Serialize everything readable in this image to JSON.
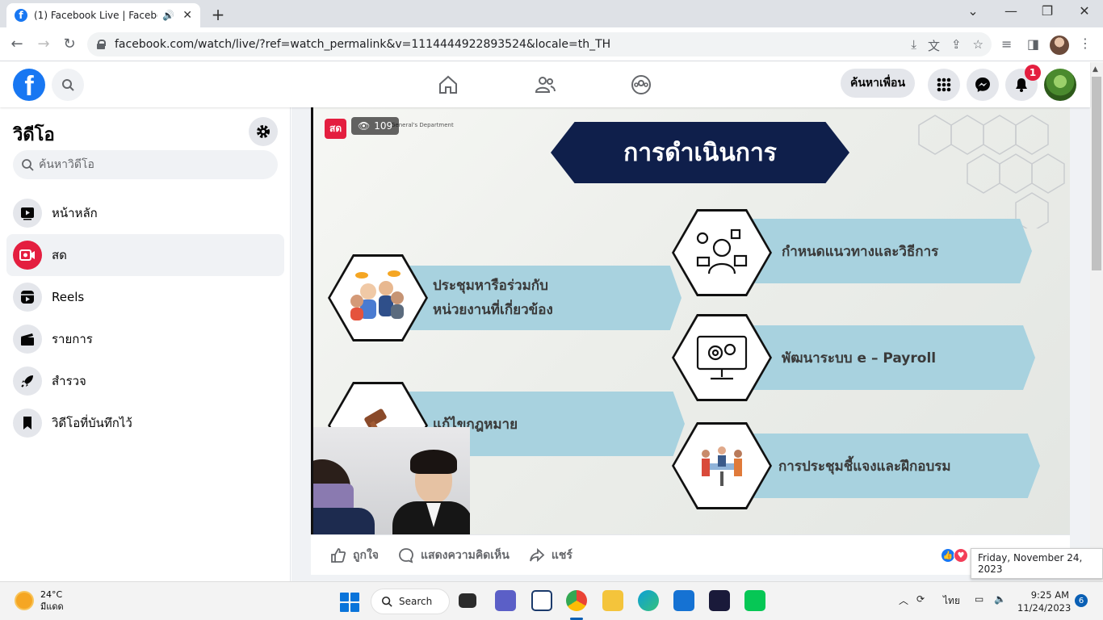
{
  "browser": {
    "tab_title": "(1) Facebook Live | Facebook",
    "url": "facebook.com/watch/live/?ref=watch_permalink&v=1114444922893524&locale=th_TH"
  },
  "header": {
    "find_friends": "ค้นหาเพื่อน",
    "notification_count": "1"
  },
  "sidebar": {
    "title": "วิดีโอ",
    "search_placeholder": "ค้นหาวิดีโอ",
    "items": [
      {
        "label": "หน้าหลัก",
        "icon": "video-play-icon"
      },
      {
        "label": "สด",
        "icon": "live-camera-icon"
      },
      {
        "label": "Reels",
        "icon": "reels-icon"
      },
      {
        "label": "รายการ",
        "icon": "clapperboard-icon"
      },
      {
        "label": "สำรวจ",
        "icon": "rocket-icon"
      },
      {
        "label": "วิดีโอที่บันทึกไว้",
        "icon": "bookmark-icon"
      }
    ]
  },
  "video": {
    "live_badge": "สด",
    "viewer_count": "109",
    "department_label": "General's Department",
    "slide": {
      "title": "การดำเนินการ",
      "left_items": [
        "ประชุมหารือร่วมกับ\nหน่วยงานที่เกี่ยวข้อง",
        "แก้ไขกฎหมาย"
      ],
      "right_items": [
        "กำหนดแนวทางและวิธีการ",
        "พัฒนาระบบ e – Payroll",
        "การประชุมชี้แจงและฝึกอบรม"
      ]
    }
  },
  "actions": {
    "like": "ถูกใจ",
    "comment": "แสดงความคิดเห็น",
    "share": "แชร์"
  },
  "tooltip": {
    "date": "Friday, November 24, 2023"
  },
  "taskbar": {
    "weather_temp": "24°C",
    "weather_desc": "มีแดด",
    "search_label": "Search",
    "language": "ไทย",
    "time": "9:25 AM",
    "date": "11/24/2023",
    "notification_count": "6"
  }
}
